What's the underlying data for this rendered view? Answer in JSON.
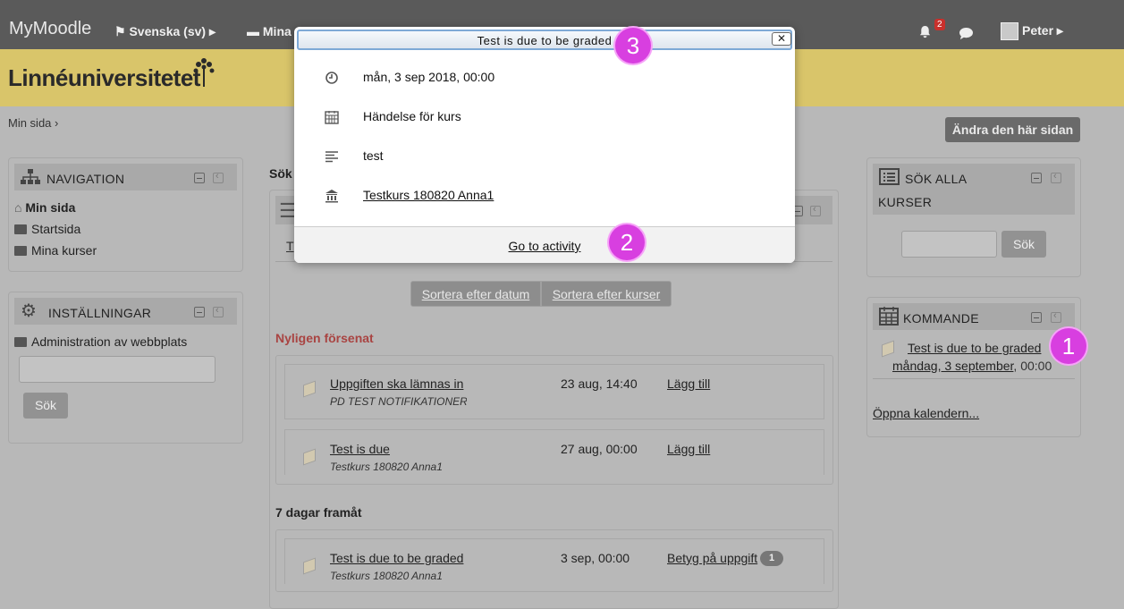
{
  "navbar": {
    "brand": "MyMoodle",
    "language": "Svenska (sv)",
    "courses": "Mina",
    "notification_count": "2",
    "user": "Peter"
  },
  "header": {
    "logo": "Linnéuniversitetet"
  },
  "breadcrumb": {
    "item": "Min sida",
    "sep": "›"
  },
  "edit_button": "Ändra den här sidan",
  "navigation_block": {
    "title": "NAVIGATION",
    "items": [
      "Min sida",
      "Startsida",
      "Mina kurser"
    ]
  },
  "settings_block": {
    "title": "INSTÄLLNINGAR",
    "item": "Administration av webbplats",
    "search_button": "Sök"
  },
  "center": {
    "title": "Sök",
    "tab_letter": "T",
    "sort_by_date": "Sortera efter datum",
    "sort_by_course": "Sortera efter kurser",
    "overdue_title": "Nyligen försenat",
    "next7_title": "7 dagar framåt",
    "overdue": [
      {
        "name": "Uppgiften ska lämnas in",
        "course": "PD TEST NOTIFIKATIONER",
        "date": "23 aug, 14:40",
        "action": "Lägg till"
      },
      {
        "name": "Test is due",
        "course": "Testkurs 180820 Anna1",
        "date": "27 aug, 00:00",
        "action": "Lägg till"
      }
    ],
    "upcoming": [
      {
        "name": "Test is due to be graded",
        "course": "Testkurs 180820 Anna1",
        "date": "3 sep, 00:00",
        "action": "Betyg på uppgift",
        "count": "1"
      }
    ]
  },
  "search_block": {
    "title_line1": "SÖK ALLA",
    "title_line2": "KURSER",
    "button": "Sök"
  },
  "upcoming_block": {
    "title": "KOMMANDE",
    "event_name": "Test is due to be graded",
    "event_date": "måndag, 3 september",
    "event_time": ", 00:00",
    "calendar_link": "Öppna kalendern..."
  },
  "popup": {
    "title": "Test is due to be graded",
    "close": "✕",
    "datetime": "mån, 3 sep 2018, 00:00",
    "event_type": "Händelse för kurs",
    "description": "test",
    "course": "Testkurs 180820 Anna1",
    "footer_link": "Go to activity"
  },
  "markers": [
    "1",
    "2",
    "3"
  ],
  "colors": {
    "navbar": "#5a5a5a",
    "header": "#d9c56a",
    "overdue": "#a94442",
    "marker": "#d83fe0"
  }
}
